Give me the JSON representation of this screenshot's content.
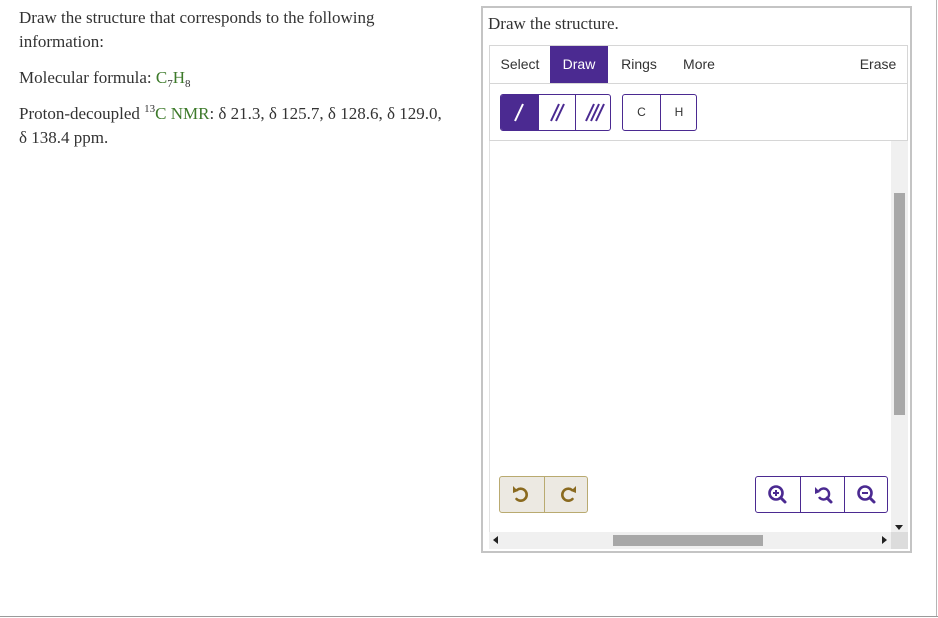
{
  "question": {
    "prompt": "Draw the structure that corresponds to the following information:",
    "formula_label": "Molecular formula: ",
    "formula_c": "C",
    "formula_c_sub": "7",
    "formula_h": "H",
    "formula_h_sub": "8",
    "nmr_prefix": "Proton-decoupled ",
    "nmr_sup": "13",
    "nmr_label": "C NMR",
    "nmr_values": ": δ 21.3, δ 125.7, δ 128.6, δ 129.0, δ 138.4 ppm."
  },
  "widget": {
    "title": "Draw the structure.",
    "tabs": [
      {
        "label": "Select",
        "active": false
      },
      {
        "label": "Draw",
        "active": true
      },
      {
        "label": "Rings",
        "active": false
      },
      {
        "label": "More",
        "active": false
      },
      {
        "label": "Erase",
        "active": false
      }
    ],
    "bond_tools": [
      {
        "icon": "single-bond-icon",
        "active": true
      },
      {
        "icon": "double-bond-icon",
        "active": false
      },
      {
        "icon": "triple-bond-icon",
        "active": false
      }
    ],
    "atoms": [
      "C",
      "H"
    ],
    "history": [
      {
        "icon": "undo-icon"
      },
      {
        "icon": "redo-icon"
      }
    ],
    "zoom": [
      {
        "icon": "zoom-in-icon"
      },
      {
        "icon": "reset-zoom-icon"
      },
      {
        "icon": "zoom-out-icon"
      }
    ]
  },
  "colors": {
    "accent": "#4b2a91",
    "text_green": "#3d7a2a",
    "history_border": "#b9aa70",
    "history_icon": "#8a6a1f"
  }
}
